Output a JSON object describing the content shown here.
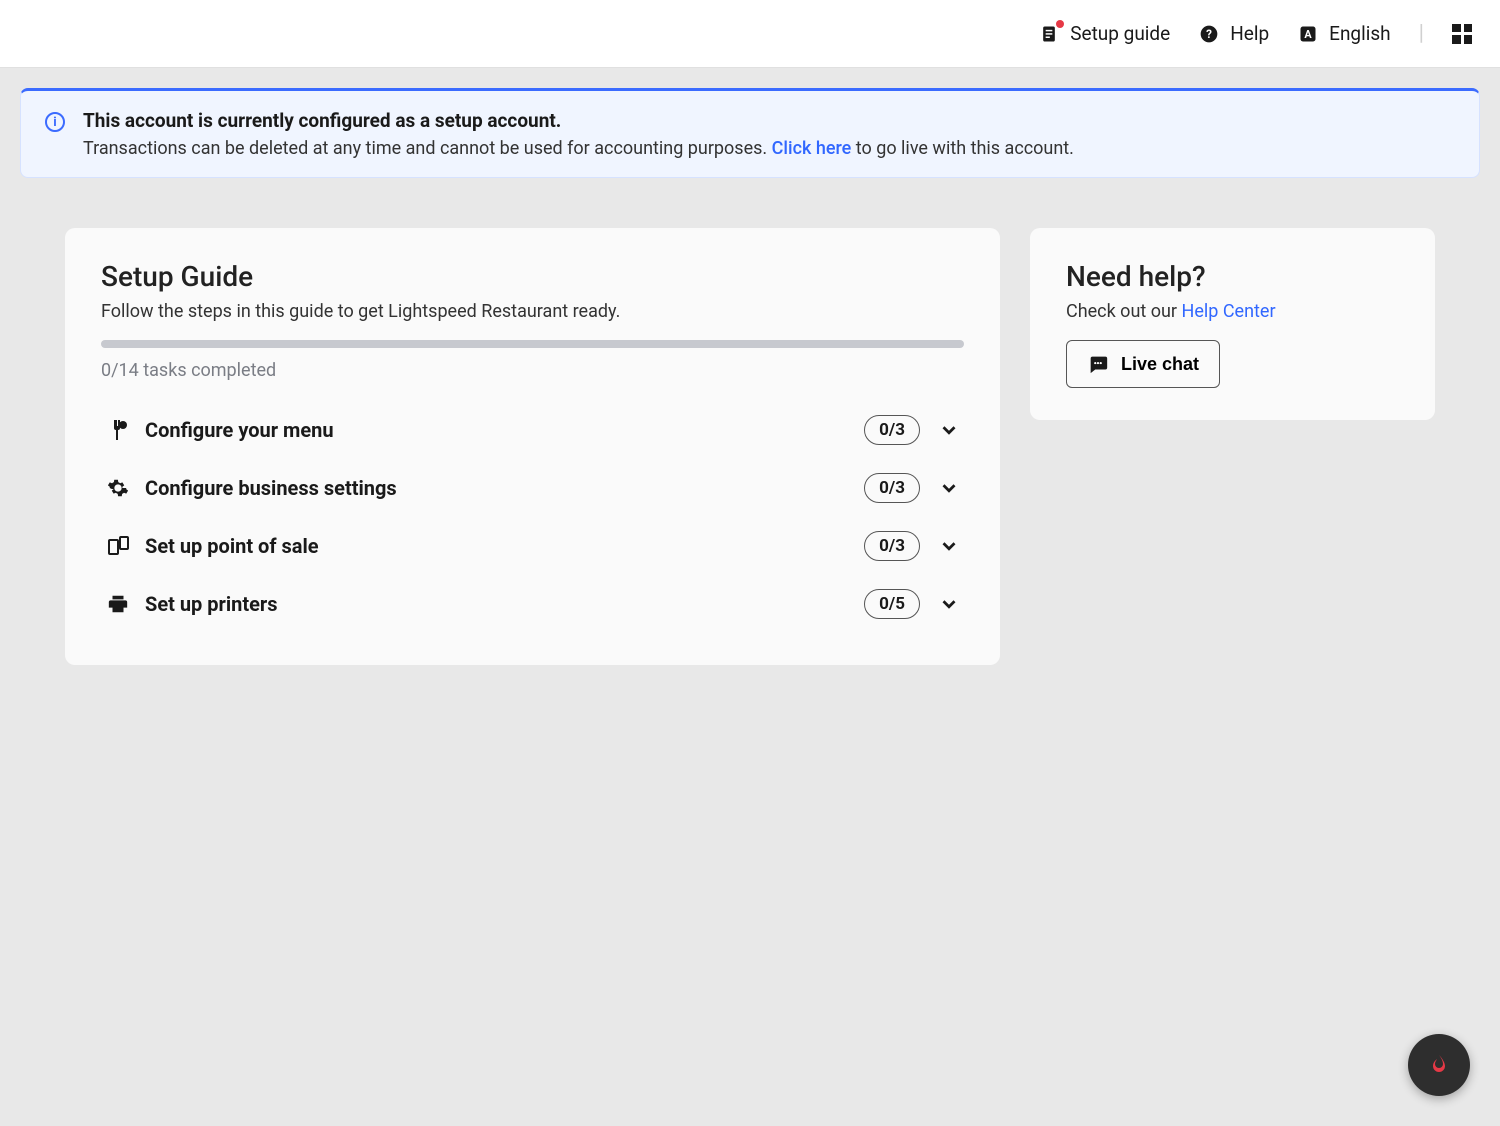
{
  "topbar": {
    "setup_guide": "Setup guide",
    "help": "Help",
    "language": "English"
  },
  "alert": {
    "title": "This account is currently configured as a setup account.",
    "text_before": "Transactions can be deleted at any time and cannot be used for accounting purposes. ",
    "link": "Click here",
    "text_after": " to go live with this account."
  },
  "setup": {
    "title": "Setup Guide",
    "subtitle": "Follow the steps in this guide to get Lightspeed Restaurant ready.",
    "progress_text": "0/14 tasks completed",
    "tasks": [
      {
        "label": "Configure your menu",
        "count": "0/3",
        "icon": "restaurant"
      },
      {
        "label": "Configure business settings",
        "count": "0/3",
        "icon": "gear"
      },
      {
        "label": "Set up point of sale",
        "count": "0/3",
        "icon": "devices"
      },
      {
        "label": "Set up printers",
        "count": "0/5",
        "icon": "printer"
      }
    ]
  },
  "help_card": {
    "title": "Need help?",
    "text": "Check out our ",
    "link": "Help Center",
    "live_chat": "Live chat"
  }
}
